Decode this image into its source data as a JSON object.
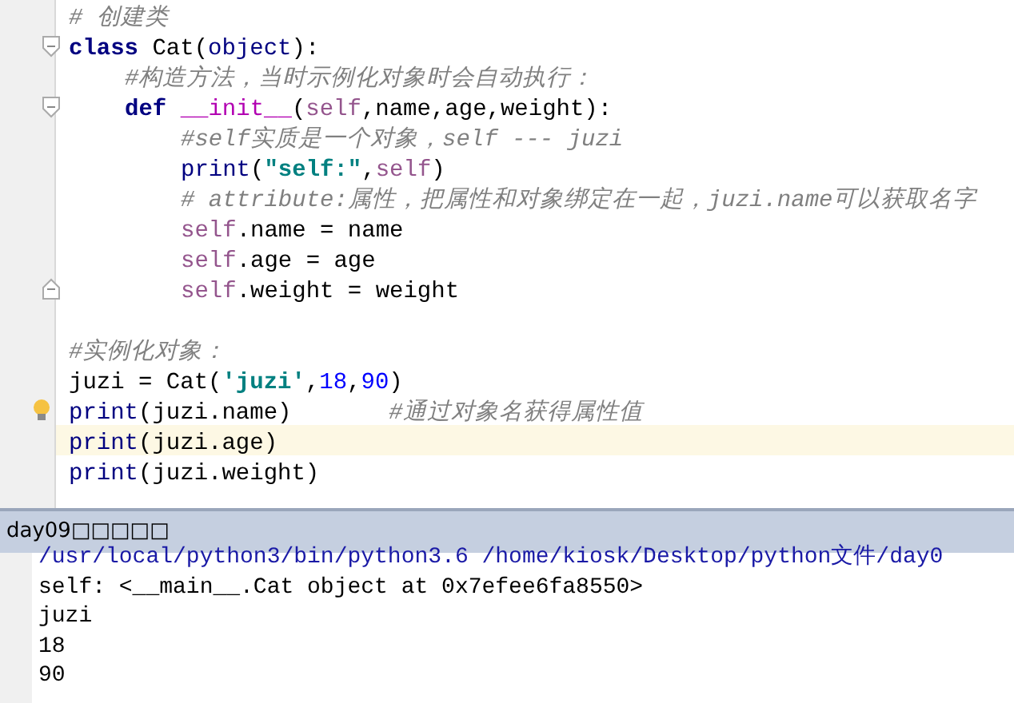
{
  "editor": {
    "lines": [
      {
        "tokens": [
          {
            "color": "#808080",
            "italic": true,
            "t": "# 创建类"
          }
        ]
      },
      {
        "expanded": true,
        "spacer_after": true,
        "tokens": [
          {
            "color": "#000080",
            "bold": true,
            "t": "class"
          },
          {
            "color": "#000000",
            "t": " Cat("
          },
          {
            "color": "#000080",
            "t": "object"
          },
          {
            "color": "#000000",
            "t": "):"
          }
        ],
        "children": [
          {
            "tokens": [
              {
                "color": "#808080",
                "italic": true,
                "t": "#构造方法，当时示例化对象时会自动执行："
              }
            ]
          },
          {
            "expanded": true,
            "tokens": [
              {
                "color": "#000080",
                "bold": true,
                "t": "def "
              },
              {
                "color": "#b200b2",
                "t": "__init__"
              },
              {
                "color": "#000000",
                "t": "("
              },
              {
                "color": "#94558d",
                "t": "self"
              },
              {
                "color": "#000000",
                "t": ",name,age,weight):"
              }
            ],
            "children": [
              {
                "tokens": [
                  {
                    "color": "#808080",
                    "italic": true,
                    "t": "#self实质是一个对象，self --- juzi"
                  }
                ]
              },
              {
                "tokens": [
                  {
                    "color": "#000080",
                    "t": "print"
                  },
                  {
                    "color": "#000000",
                    "t": "("
                  },
                  {
                    "color": "#008080",
                    "bold": true,
                    "t": "\"self:\""
                  },
                  {
                    "color": "#000000",
                    "t": ","
                  },
                  {
                    "color": "#94558d",
                    "t": "self"
                  },
                  {
                    "color": "#000000",
                    "t": ")"
                  }
                ]
              },
              {
                "tokens": [
                  {
                    "color": "#808080",
                    "italic": true,
                    "t": "# attribute:属性，把属性和对象绑定在一起，juzi.name可以获取名字"
                  }
                ]
              },
              {
                "tokens": [
                  {
                    "color": "#94558d",
                    "t": "self"
                  },
                  {
                    "color": "#000000",
                    "t": ".name = name"
                  }
                ]
              },
              {
                "tokens": [
                  {
                    "color": "#94558d",
                    "t": "self"
                  },
                  {
                    "color": "#000000",
                    "t": ".age = age"
                  }
                ]
              },
              {
                "tokens": [
                  {
                    "color": "#94558d",
                    "t": "self"
                  },
                  {
                    "color": "#000000",
                    "t": ".weight = weight"
                  }
                ]
              }
            ]
          }
        ]
      },
      {
        "tokens": [
          {
            "color": "#808080",
            "italic": true,
            "t": "#实例化对象："
          }
        ]
      },
      {
        "tokens": [
          {
            "color": "#000000",
            "t": "juzi = Cat("
          },
          {
            "color": "#008080",
            "bold": true,
            "t": "'juzi'"
          },
          {
            "color": "#000000",
            "t": ","
          },
          {
            "color": "#0000ff",
            "t": "18"
          },
          {
            "color": "#000000",
            "t": ","
          },
          {
            "color": "#0000ff",
            "t": "90"
          },
          {
            "color": "#000000",
            "t": ")"
          }
        ]
      },
      {
        "bulb": true,
        "tokens": [
          {
            "color": "#000080",
            "t": "print"
          },
          {
            "color": "#000000",
            "t": "(juzi.name)       "
          },
          {
            "color": "#808080",
            "italic": true,
            "t": "#通过对象名获得属性值"
          }
        ]
      },
      {
        "current": true,
        "tokens": [
          {
            "color": "#000080",
            "t": "print"
          },
          {
            "color": "#000000",
            "t": "(juzi.age)"
          }
        ]
      },
      {
        "tokens": [
          {
            "color": "#000080",
            "t": "print"
          },
          {
            "color": "#000000",
            "t": "(juzi.weight)"
          }
        ]
      }
    ]
  },
  "run_panel": {
    "title": "day09□□□□□",
    "output": [
      {
        "kind": "command",
        "text": "/usr/local/python3/bin/python3.6 /home/kiosk/Desktop/python文件/day0"
      },
      {
        "kind": "stdout",
        "text": "self: <__main__.Cat object at 0x7efee6fa8550>"
      },
      {
        "kind": "stdout",
        "text": "juzi"
      },
      {
        "kind": "stdout",
        "text": "18"
      },
      {
        "kind": "stdout",
        "text": "90"
      }
    ]
  }
}
